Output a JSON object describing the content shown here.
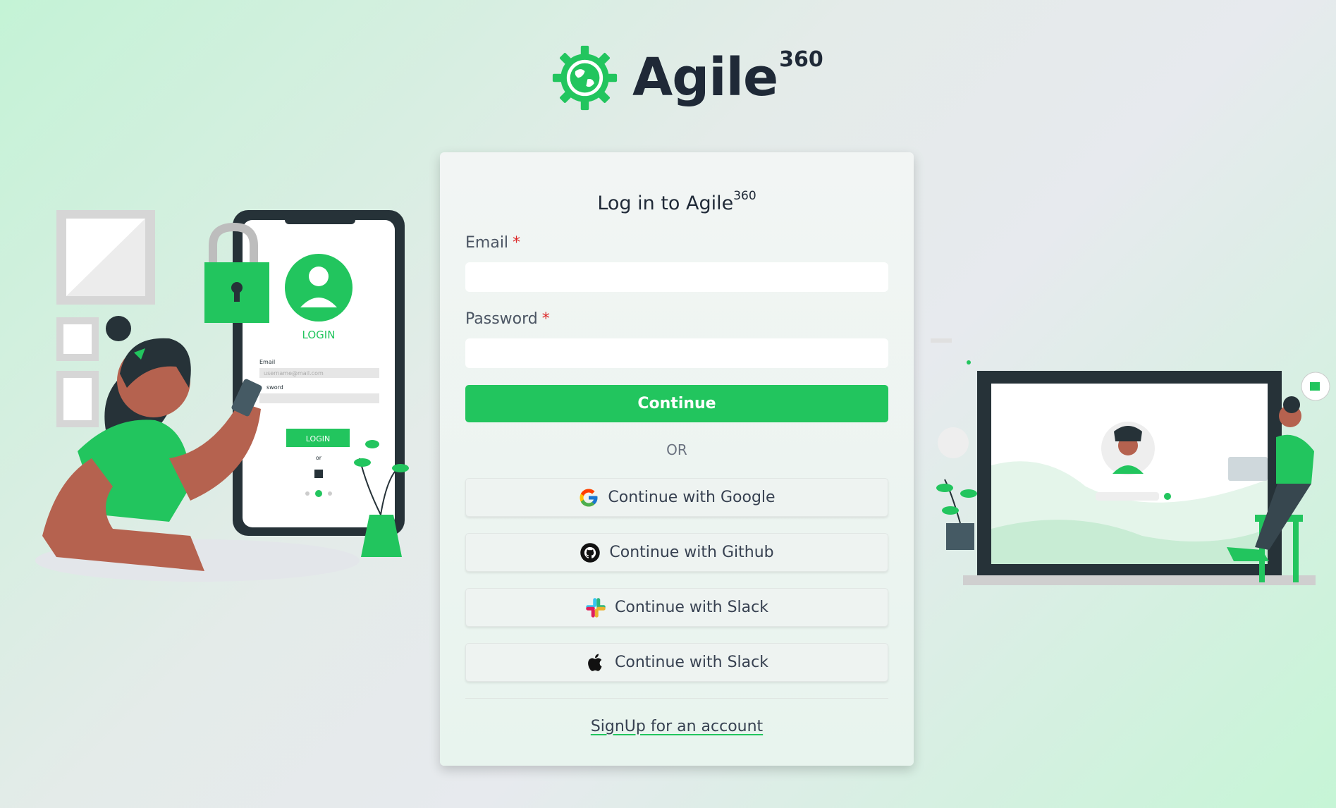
{
  "brand": {
    "name": "Agile",
    "sup": "360"
  },
  "card": {
    "title": "Log in to Agile",
    "title_sup": "360",
    "email_label": "Email",
    "password_label": "Password",
    "required_mark": "*",
    "email_value": "",
    "password_value": "",
    "continue_label": "Continue",
    "or_label": "OR",
    "social": [
      {
        "label": "Continue with Google",
        "icon": "google-icon"
      },
      {
        "label": "Continue with Github",
        "icon": "github-icon"
      },
      {
        "label": "Continue with Slack",
        "icon": "slack-icon"
      },
      {
        "label": "Continue with Slack",
        "icon": "apple-icon"
      }
    ],
    "signup_label": "SignUp for an account"
  },
  "left_illustration": {
    "login_title": "LOGIN",
    "email_label": "Email",
    "email_placeholder": "username@mail.com",
    "password_label": "sword",
    "login_button": "LOGIN",
    "or": "or"
  },
  "colors": {
    "accent": "#22c55e",
    "text": "#1f2937",
    "required": "#dc2626"
  }
}
